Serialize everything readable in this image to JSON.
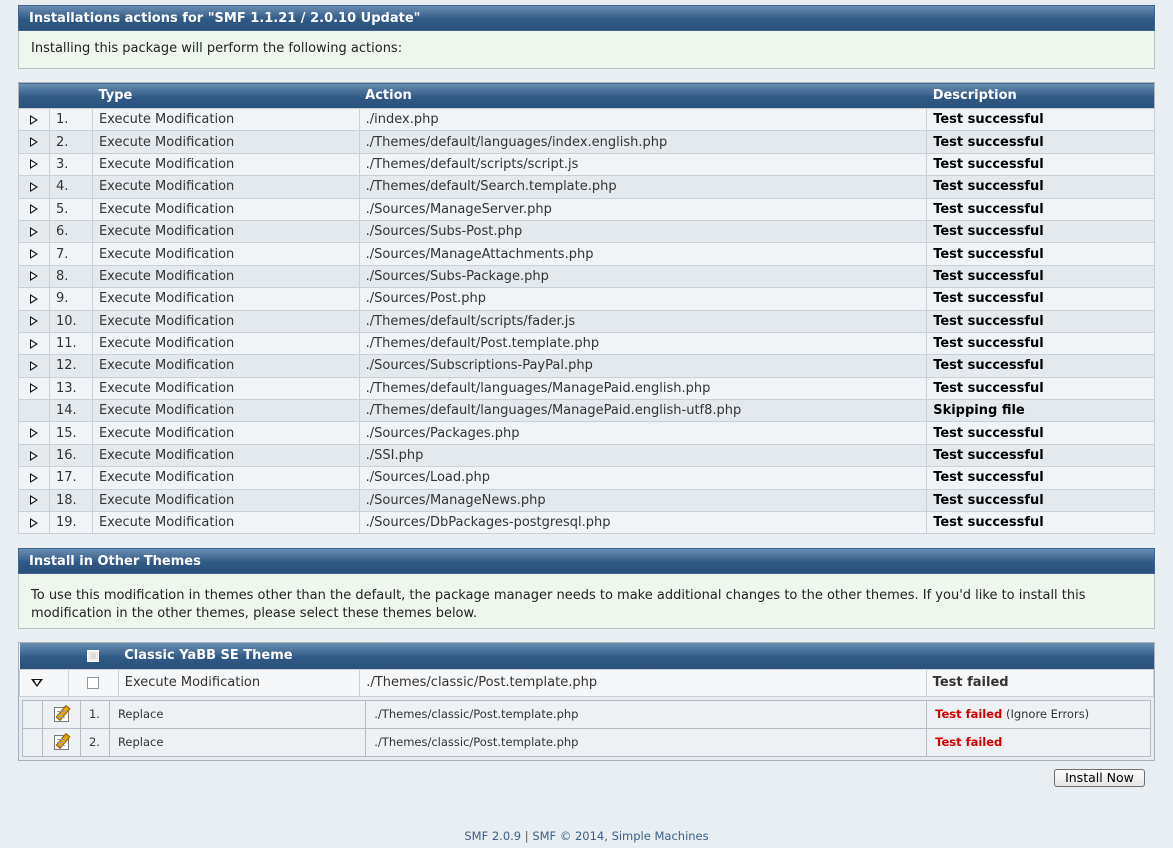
{
  "install_section": {
    "title": "Installations actions for \"SMF 1.1.21 / 2.0.10 Update\"",
    "intro": "Installing this package will perform the following actions:"
  },
  "actions_table": {
    "headers": {
      "type": "Type",
      "action": "Action",
      "description": "Description"
    },
    "rows": [
      {
        "num": "1.",
        "type": "Execute Modification",
        "action": "./index.php",
        "desc": "Test successful",
        "expandable": true
      },
      {
        "num": "2.",
        "type": "Execute Modification",
        "action": "./Themes/default/languages/index.english.php",
        "desc": "Test successful",
        "expandable": true
      },
      {
        "num": "3.",
        "type": "Execute Modification",
        "action": "./Themes/default/scripts/script.js",
        "desc": "Test successful",
        "expandable": true
      },
      {
        "num": "4.",
        "type": "Execute Modification",
        "action": "./Themes/default/Search.template.php",
        "desc": "Test successful",
        "expandable": true
      },
      {
        "num": "5.",
        "type": "Execute Modification",
        "action": "./Sources/ManageServer.php",
        "desc": "Test successful",
        "expandable": true
      },
      {
        "num": "6.",
        "type": "Execute Modification",
        "action": "./Sources/Subs-Post.php",
        "desc": "Test successful",
        "expandable": true
      },
      {
        "num": "7.",
        "type": "Execute Modification",
        "action": "./Sources/ManageAttachments.php",
        "desc": "Test successful",
        "expandable": true
      },
      {
        "num": "8.",
        "type": "Execute Modification",
        "action": "./Sources/Subs-Package.php",
        "desc": "Test successful",
        "expandable": true
      },
      {
        "num": "9.",
        "type": "Execute Modification",
        "action": "./Sources/Post.php",
        "desc": "Test successful",
        "expandable": true
      },
      {
        "num": "10.",
        "type": "Execute Modification",
        "action": "./Themes/default/scripts/fader.js",
        "desc": "Test successful",
        "expandable": true
      },
      {
        "num": "11.",
        "type": "Execute Modification",
        "action": "./Themes/default/Post.template.php",
        "desc": "Test successful",
        "expandable": true
      },
      {
        "num": "12.",
        "type": "Execute Modification",
        "action": "./Sources/Subscriptions-PayPal.php",
        "desc": "Test successful",
        "expandable": true
      },
      {
        "num": "13.",
        "type": "Execute Modification",
        "action": "./Themes/default/languages/ManagePaid.english.php",
        "desc": "Test successful",
        "expandable": true
      },
      {
        "num": "14.",
        "type": "Execute Modification",
        "action": "./Themes/default/languages/ManagePaid.english-utf8.php",
        "desc": "Skipping file",
        "expandable": false
      },
      {
        "num": "15.",
        "type": "Execute Modification",
        "action": "./Sources/Packages.php",
        "desc": "Test successful",
        "expandable": true
      },
      {
        "num": "16.",
        "type": "Execute Modification",
        "action": "./SSI.php",
        "desc": "Test successful",
        "expandable": true
      },
      {
        "num": "17.",
        "type": "Execute Modification",
        "action": "./Sources/Load.php",
        "desc": "Test successful",
        "expandable": true
      },
      {
        "num": "18.",
        "type": "Execute Modification",
        "action": "./Sources/ManageNews.php",
        "desc": "Test successful",
        "expandable": true
      },
      {
        "num": "19.",
        "type": "Execute Modification",
        "action": "./Sources/DbPackages-postgresql.php",
        "desc": "Test successful",
        "expandable": true
      }
    ]
  },
  "other_themes": {
    "title": "Install in Other Themes",
    "intro": "To use this modification in themes other than the default, the package manager needs to make additional changes to the other themes. If you'd like to install this modification in the other themes, please select these themes below.",
    "theme_name": "Classic YaBB SE Theme",
    "main_row": {
      "type": "Execute Modification",
      "action": "./Themes/classic/Post.template.php",
      "desc": "Test failed"
    },
    "sub_rows": [
      {
        "num": "1.",
        "type": "Replace",
        "action": "./Themes/classic/Post.template.php",
        "desc": "Test failed",
        "note": "(Ignore Errors)"
      },
      {
        "num": "2.",
        "type": "Replace",
        "action": "./Themes/classic/Post.template.php",
        "desc": "Test failed",
        "note": ""
      }
    ]
  },
  "install_button": "Install Now",
  "footer": {
    "version": "SMF 2.0.9",
    "sep": "|",
    "copyright": "SMF © 2014",
    "comma": ",",
    "company": "Simple Machines"
  },
  "colors": {
    "header_gradient_top": "#6a8eb2",
    "header_gradient_bottom": "#2a517a",
    "fail_red": "#d10000",
    "info_bg": "#eef6ee"
  }
}
